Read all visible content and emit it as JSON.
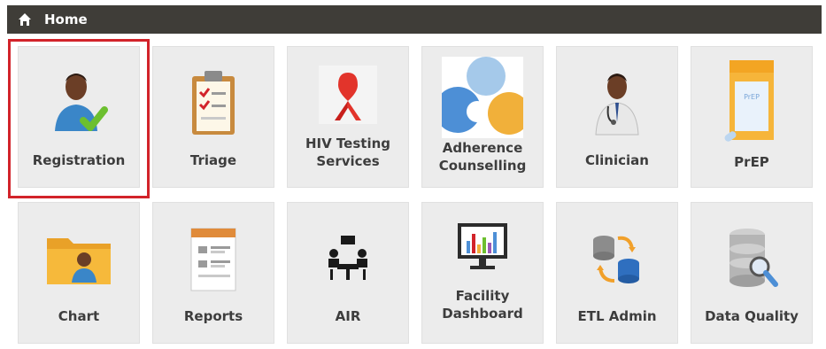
{
  "header": {
    "title": "Home",
    "icon": "home-icon"
  },
  "tiles": [
    {
      "label": "Registration",
      "icon": "registration-icon"
    },
    {
      "label": "Triage",
      "icon": "clipboard-icon"
    },
    {
      "label": "HIV Testing Services",
      "icon": "ribbon-icon"
    },
    {
      "label": "Adherence Counselling",
      "icon": "speech-bubbles-icon"
    },
    {
      "label": "Clinician",
      "icon": "doctor-icon"
    },
    {
      "label": "PrEP",
      "icon": "pill-bottle-icon"
    },
    {
      "label": "Chart",
      "icon": "folder-icon"
    },
    {
      "label": "Reports",
      "icon": "report-icon"
    },
    {
      "label": "AIR",
      "icon": "meeting-icon"
    },
    {
      "label": "Facility Dashboard",
      "icon": "monitor-chart-icon"
    },
    {
      "label": "ETL Admin",
      "icon": "database-sync-icon"
    },
    {
      "label": "Data Quality",
      "icon": "database-search-icon"
    }
  ],
  "pill_bottle_text": "PrEP",
  "colors": {
    "highlight": "#d2232a",
    "header_bg": "#3f3d38",
    "tile_bg": "#ececec"
  }
}
